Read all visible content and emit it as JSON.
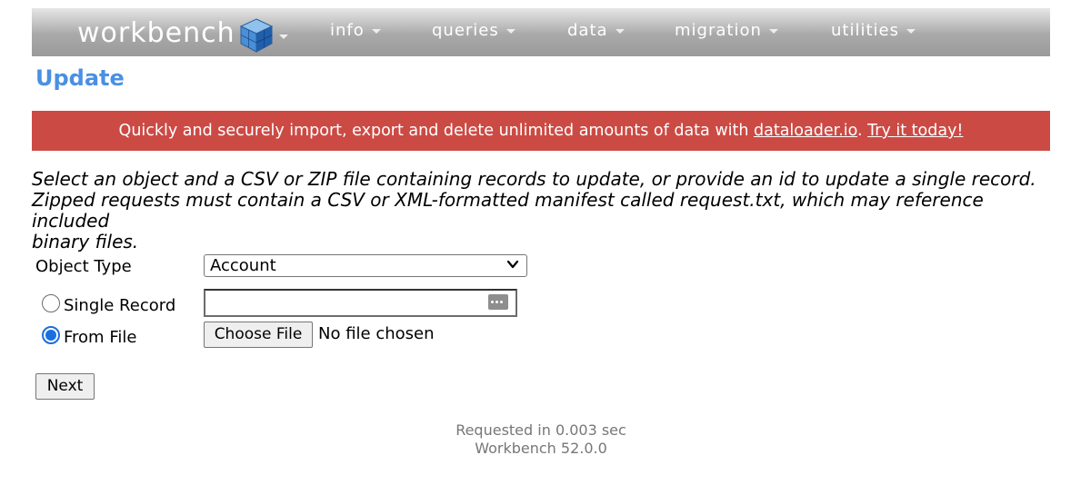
{
  "navbar": {
    "brand": "workbench",
    "menus": [
      "info",
      "queries",
      "data",
      "migration",
      "utilities"
    ]
  },
  "page": {
    "title": "Update"
  },
  "banner": {
    "text_before": "Quickly and securely import, export and delete unlimited amounts of data with ",
    "link_text": "dataloader.io",
    "text_middle": ". ",
    "cta_text": "Try it today!"
  },
  "instructions": {
    "line1": "Select an object and a CSV or ZIP file containing records to update, or provide an id to update a single record.",
    "line2": "Zipped requests must contain a CSV or XML-formatted manifest called request.txt, which may reference included",
    "line3": "binary files."
  },
  "form": {
    "object_type_label": "Object Type",
    "object_type_value": "Account",
    "single_record_label": "Single Record",
    "single_record_value": "",
    "from_file_label": "From File",
    "selected_mode": "from_file",
    "choose_file_label": "Choose File",
    "no_file_text": "No file chosen",
    "next_label": "Next"
  },
  "footer": {
    "requested": "Requested in 0.003 sec",
    "version": "Workbench 52.0.0"
  },
  "colors": {
    "title_blue": "#4a90e2",
    "banner_red": "#cc4a44",
    "radio_blue": "#1a6fe0"
  }
}
